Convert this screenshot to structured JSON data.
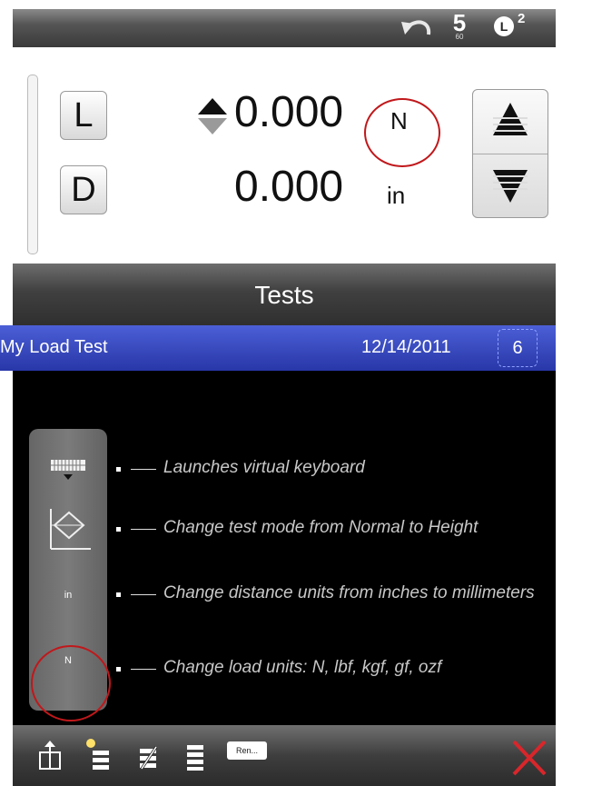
{
  "status_bar": {
    "undo_icon": "undo-arrow-icon",
    "s_indicator": {
      "big": "5",
      "small": "60"
    },
    "load_cell": {
      "letter": "L",
      "superscript": "2"
    }
  },
  "readout": {
    "load_key": "L",
    "distance_key": "D",
    "load_value": "0.000",
    "load_unit": "N",
    "distance_value": "0.000",
    "distance_unit": "in"
  },
  "tests": {
    "header": "Tests",
    "selected_row": {
      "name": "My Load Test",
      "date": "12/14/2011",
      "count": "6"
    }
  },
  "tool_panel": {
    "distance_units_label": "in",
    "load_units_label": "N"
  },
  "callouts": [
    {
      "text": "Launches virtual keyboard"
    },
    {
      "text": "Change test mode from Normal to Height"
    },
    {
      "text": "Change distance units from inches to millimeters"
    },
    {
      "text": "Change load units: N, lbf, kgf, gf, ozf"
    }
  ],
  "bottom_toolbar": {
    "rename_label": "Ren..."
  },
  "colors": {
    "accent_row": "#2f3fb8",
    "highlight_circle": "#c0181b",
    "close_x": "#d8262b"
  }
}
